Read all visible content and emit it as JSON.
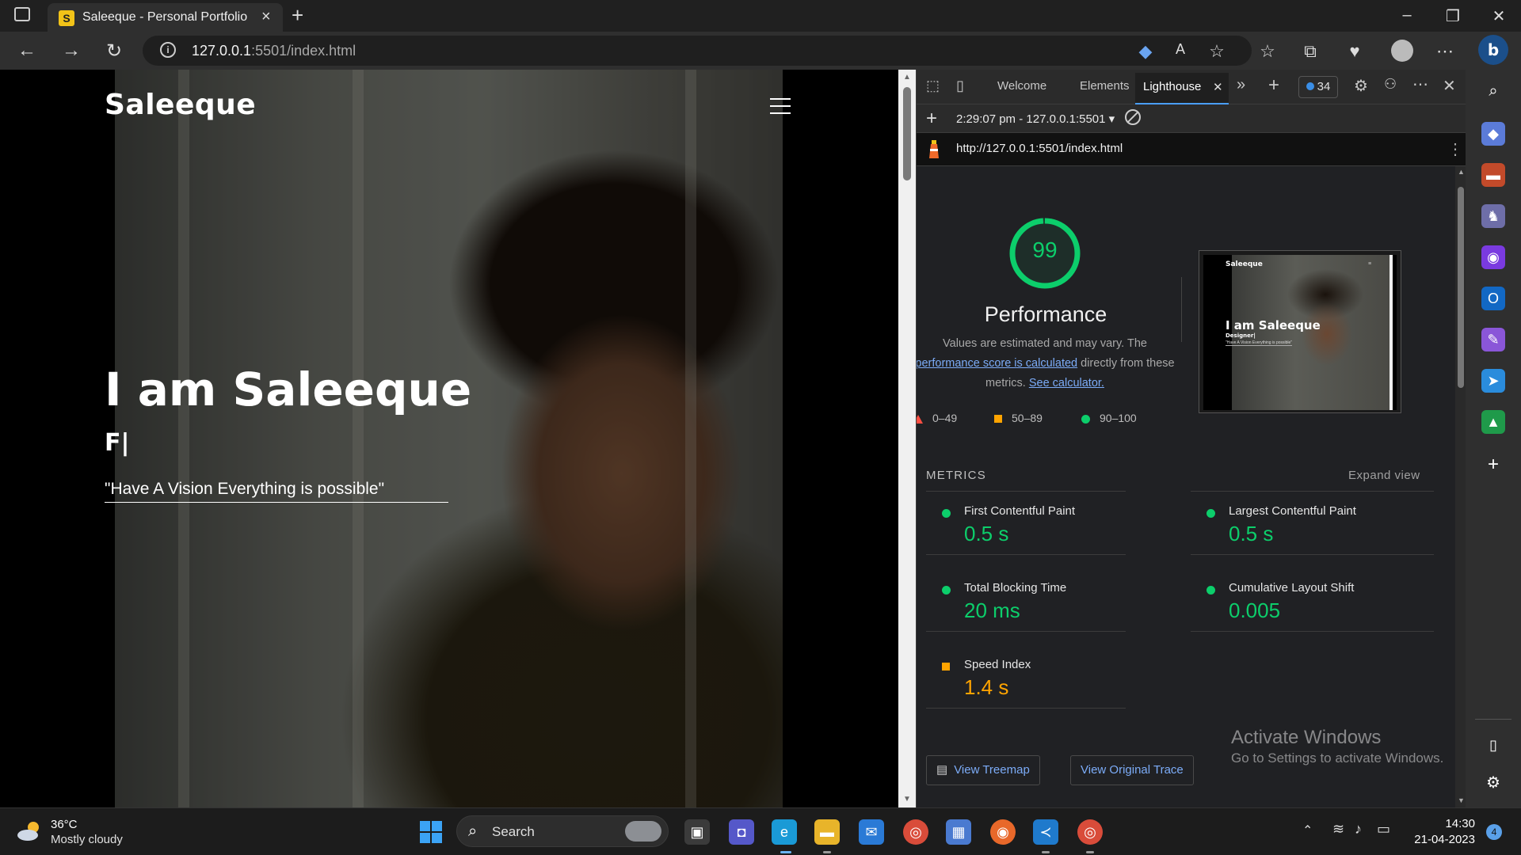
{
  "browser": {
    "tab_title": "Saleeque - Personal Portfolio",
    "tab_favicon": "S",
    "new_tab": "+",
    "url_host": "127.0.0.1",
    "url_rest": ":5501/index.html"
  },
  "site": {
    "logo": "Saleeque",
    "hero_title": "I am Saleeque",
    "hero_typed": "F|",
    "hero_quote": "\"Have A Vision Everything is possible\""
  },
  "devtools": {
    "tabs": [
      "Welcome",
      "Elements",
      "Lighthouse"
    ],
    "issues_count": "34",
    "run_label": "2:29:07 pm - 127.0.0.1:5501",
    "report_url": "http://127.0.0.1:5501/index.html",
    "score": "99",
    "score_value": 0.99,
    "category": "Performance",
    "note_pre": "Values are estimated and may vary. The ",
    "note_link": "performance score is calculated",
    "note_mid": " directly from these metrics. ",
    "note_link2": "See calculator.",
    "legend": [
      "0–49",
      "50–89",
      "90–100"
    ],
    "preview": {
      "logo": "Saleeque",
      "title": "I am Saleeque",
      "sub": "Designer|",
      "quote": "\"Have A Vision Everything is possible\""
    },
    "metrics_heading": "METRICS",
    "expand_label": "Expand view",
    "metrics": [
      {
        "name": "First Contentful Paint",
        "value": "0.5 s",
        "status": "pass"
      },
      {
        "name": "Largest Contentful Paint",
        "value": "0.5 s",
        "status": "pass"
      },
      {
        "name": "Total Blocking Time",
        "value": "20 ms",
        "status": "pass"
      },
      {
        "name": "Cumulative Layout Shift",
        "value": "0.005",
        "status": "pass"
      },
      {
        "name": "Speed Index",
        "value": "1.4 s",
        "status": "average"
      }
    ],
    "btn_treemap": "View Treemap",
    "btn_trace": "View Original Trace"
  },
  "watermark": {
    "line1": "Activate Windows",
    "line2": "Go to Settings to activate Windows."
  },
  "taskbar": {
    "temp": "36°C",
    "weather": "Mostly cloudy",
    "search": "Search",
    "time": "14:30",
    "date": "21-04-2023",
    "notifications": "4"
  },
  "colors": {
    "pass": "#0cce6b",
    "average": "#ffa400",
    "fail": "#ff4e42",
    "link": "#7cacf8"
  }
}
